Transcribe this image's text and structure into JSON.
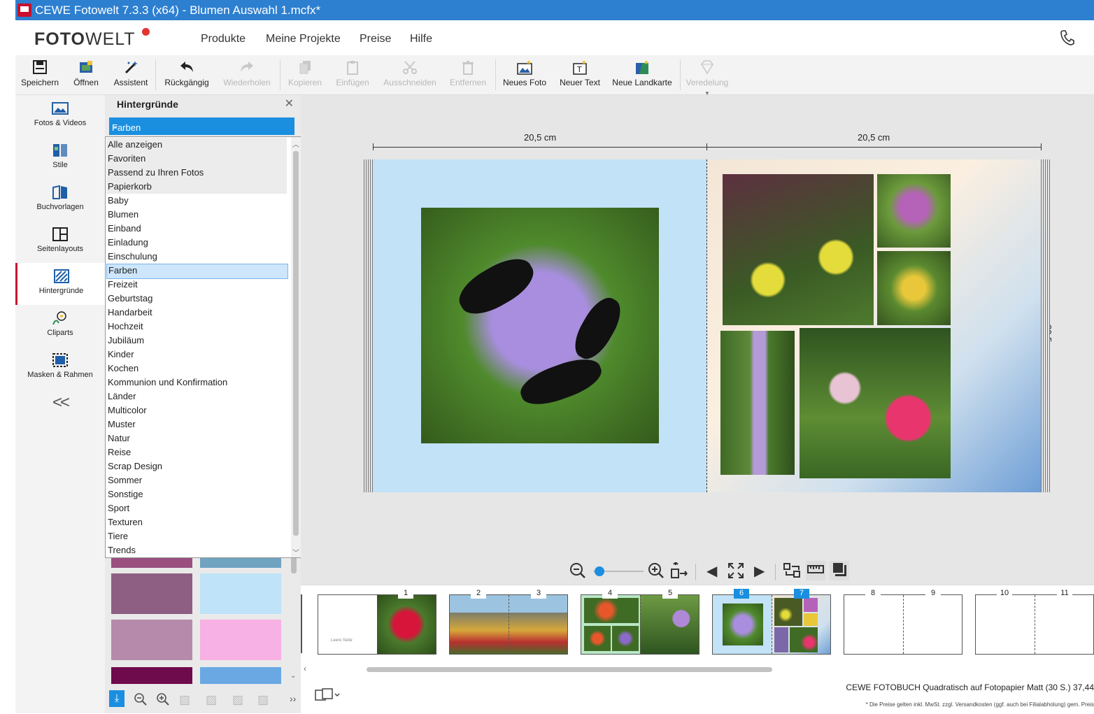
{
  "window": {
    "title": "CEWE Fotowelt 7.3.3 (x64) - Blumen Auswahl 1.mcfx*"
  },
  "nav": {
    "logo_bold": "FOTO",
    "logo_thin": "WELT",
    "links": [
      "Produkte",
      "Meine Projekte",
      "Preise",
      "Hilfe"
    ]
  },
  "toolbar": {
    "items": [
      {
        "label": "Speichern",
        "icon": "save-icon",
        "enabled": true
      },
      {
        "label": "Öffnen",
        "icon": "open-icon",
        "enabled": true
      },
      {
        "label": "Assistent",
        "icon": "wand-icon",
        "enabled": true
      },
      {
        "label": "Rückgängig",
        "icon": "undo-icon",
        "enabled": true
      },
      {
        "label": "Wiederholen",
        "icon": "redo-icon",
        "enabled": false
      },
      {
        "label": "Kopieren",
        "icon": "copy-icon",
        "enabled": false
      },
      {
        "label": "Einfügen",
        "icon": "paste-icon",
        "enabled": false
      },
      {
        "label": "Ausschneiden",
        "icon": "cut-icon",
        "enabled": false
      },
      {
        "label": "Entfernen",
        "icon": "trash-icon",
        "enabled": false
      },
      {
        "label": "Neues Foto",
        "icon": "new-photo-icon",
        "enabled": true
      },
      {
        "label": "Neuer Text",
        "icon": "new-text-icon",
        "enabled": true
      },
      {
        "label": "Neue Landkarte",
        "icon": "new-map-icon",
        "enabled": true
      },
      {
        "label": "Veredelung",
        "icon": "diamond-icon",
        "enabled": false
      }
    ]
  },
  "sidebar": {
    "items": [
      {
        "label": "Fotos & Videos",
        "icon": "photos-icon"
      },
      {
        "label": "Stile",
        "icon": "styles-icon"
      },
      {
        "label": "Buchvorlagen",
        "icon": "book-templates-icon"
      },
      {
        "label": "Seitenlayouts",
        "icon": "page-layouts-icon"
      },
      {
        "label": "Hintergründe",
        "icon": "backgrounds-icon",
        "active": true
      },
      {
        "label": "Cliparts",
        "icon": "cliparts-icon"
      },
      {
        "label": "Masken & Rahmen",
        "icon": "masks-frames-icon"
      }
    ],
    "collapse_label": "<<"
  },
  "panel": {
    "title": "Hintergründe",
    "close": "✕",
    "dropdown_value": "Farben",
    "options": [
      "Alle anzeigen",
      "Favoriten",
      "Passend zu Ihren Fotos",
      "Papierkorb",
      "Baby",
      "Blumen",
      "Einband",
      "Einladung",
      "Einschulung",
      "Farben",
      "Freizeit",
      "Geburtstag",
      "Handarbeit",
      "Hochzeit",
      "Jubiläum",
      "Kinder",
      "Kochen",
      "Kommunion und Konfirmation",
      "Länder",
      "Multicolor",
      "Muster",
      "Natur",
      "Reise",
      "Scrap Design",
      "Sommer",
      "Sonstige",
      "Sport",
      "Texturen",
      "Tiere",
      "Trends"
    ],
    "selected_index": 9,
    "swatch_colors": [
      "#9b4f80",
      "#6fa3c0",
      "#8e5f82",
      "#bfe3f8",
      "#b68aab",
      "#f8b1e4",
      "#6e0b4c",
      "#6aa8e3"
    ]
  },
  "canvas": {
    "width_left": "20,5 cm",
    "width_right": "20,5 cm",
    "height": "20,5 cm"
  },
  "filmstrip": {
    "spreads": [
      {
        "left": "1",
        "right": ""
      },
      {
        "left": "2",
        "right": "3"
      },
      {
        "left": "4",
        "right": "5"
      },
      {
        "left": "6",
        "right": "7",
        "current": true
      },
      {
        "left": "8",
        "right": "9"
      },
      {
        "left": "10",
        "right": "11"
      }
    ],
    "cover_text": "Leere Seite"
  },
  "status": {
    "price_line": "CEWE FOTOBUCH Quadratisch auf Fotopapier Matt (30 S.) 37,44",
    "note": "* Die Preise gelten inkl. MwSt. zzgl. Versandkosten (ggf. auch bei Filialabholung) gem. Preis"
  }
}
